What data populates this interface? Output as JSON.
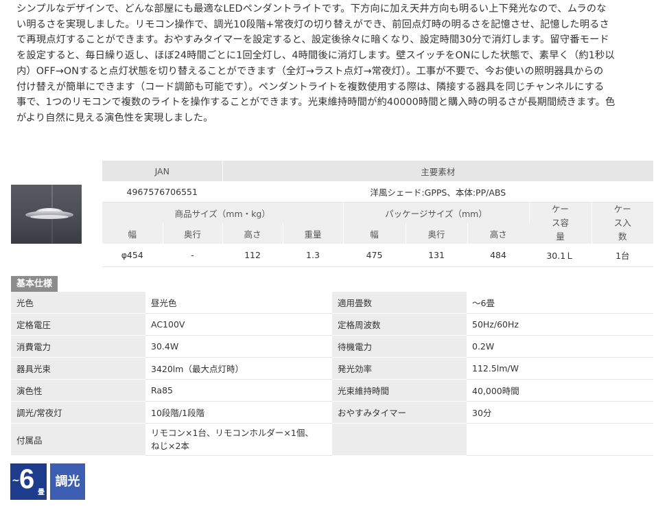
{
  "description": {
    "lines": [
      "シンプルなデザインで、どんな部屋にも最適なLEDペンダントライトです。下方向に加え天井方向も明るい上下発光なので、ムラのな",
      "い明るさを実現しました。リモコン操作で、調光10段階+常夜灯の切り替えができ、前回点灯時の明るさを記憶させ、記憶した明るさ",
      "で再現点灯することができます。おやすみタイマーを設定すると、設定後徐々に暗くなり、設定時間30分で消灯します。留守番モード",
      "を設定すると、毎日繰り返し、ほぼ24時間ごとに1回全灯し、4時間後に消灯します。壁スイッチをONにした状態で、素早く（約1秒以",
      "内）OFF→ONすると点灯状態を切り替えることができます（全灯→ラスト点灯→常夜灯）。工事が不要で、今お使いの照明器具からの",
      "付け替えが簡単にできます（コード調節も可能です）。ペンダントライトを複数使用する際は、隣接する器具を同じチャンネルにする",
      "事で、1つのリモコンで複数のライトを操作することができます。光束維持時間が約40000時間と購入時の明るさが長期間続きます。色",
      "がより自然に見える演色性を実現しました。"
    ]
  },
  "spec_table": {
    "jan_header": "JAN",
    "material_header": "主要素材",
    "jan_value": "4967576706551",
    "material_value": "洋風シェード:GPPS、本体:PP/ABS",
    "product_size_header": "商品サイズ（mm・kg）",
    "package_size_header": "パッケージサイズ（mm）",
    "case_volume_header": "ケース容量",
    "case_qty_header": "ケース入数",
    "cols": [
      "幅",
      "奥行",
      "高さ",
      "重量",
      "幅",
      "奥行",
      "高さ"
    ],
    "values": [
      "φ454",
      "-",
      "112",
      "1.3",
      "475",
      "131",
      "484",
      "30.1Ｌ",
      "1台"
    ]
  },
  "basic_specs": {
    "title": "基本仕様",
    "rows": [
      {
        "l1": "光色",
        "v1": "昼光色",
        "l2": "適用畳数",
        "v2": "～6畳"
      },
      {
        "l1": "定格電圧",
        "v1": "AC100V",
        "l2": "定格周波数",
        "v2": "50Hz/60Hz"
      },
      {
        "l1": "消費電力",
        "v1": "30.4W",
        "l2": "待機電力",
        "v2": "0.2W"
      },
      {
        "l1": "器具光束",
        "v1": "3420lm（最大点灯時）",
        "l2": "発光効率",
        "v2": "112.5lm/W"
      },
      {
        "l1": "演色性",
        "v1": "Ra85",
        "l2": "光束維持時間",
        "v2": "40,000時間"
      },
      {
        "l1": "調光/常夜灯",
        "v1": "10段階/1段階",
        "l2": "おやすみタイマー",
        "v2": "30分"
      }
    ],
    "accessories_label": "付属品",
    "accessories_line1": "リモコン×1台、リモコンホルダー×1個、",
    "accessories_line2": "ねじ×2本"
  },
  "badges": {
    "tatami_tilde": "~",
    "tatami_number": "6",
    "tatami_unit": "畳",
    "dimming": "調光"
  },
  "colors": {
    "badge_dark": "#1d3c8c",
    "badge_light": "#3d5fb3",
    "label_bg": "#ececec",
    "section_label_bg": "#8c8c8c"
  }
}
